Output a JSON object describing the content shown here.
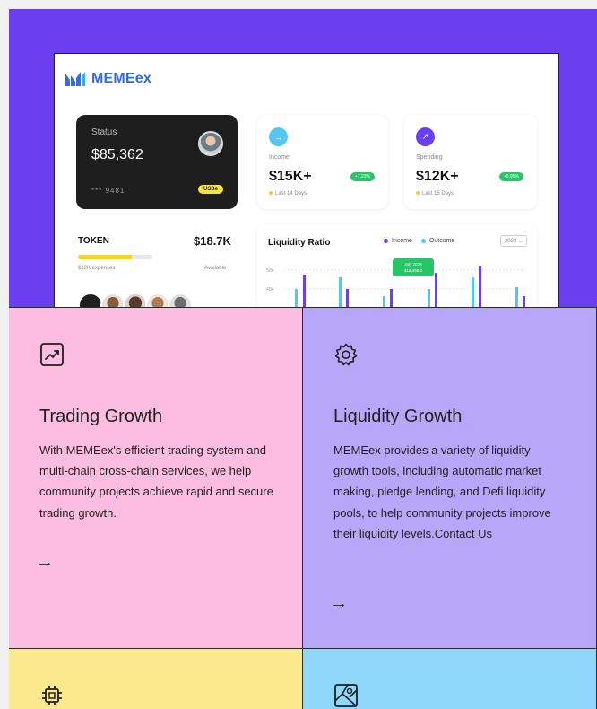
{
  "theme": {
    "hero_bg": "#6a3ff0",
    "card_pink": "#fcbde0",
    "card_lavender": "#b7a7f8",
    "card_yellow": "#fde98d",
    "card_blue": "#8fd7fb"
  },
  "dashboard": {
    "logo_text": "MEMEex",
    "status": {
      "label": "Status",
      "value": "$85,362",
      "card_number": "*** 9481",
      "pill": "USDe"
    },
    "income": {
      "label": "Income",
      "value": "$15K+",
      "badge": "+7.23%",
      "sub": "Last 14 Days",
      "color": "#54c7f0"
    },
    "spending": {
      "label": "Spending",
      "value": "$12K+",
      "badge": "+8.95%",
      "sub": "Last 15 Days",
      "color": "#6a3ff0"
    },
    "token": {
      "title": "TOKEN",
      "value": "$18.7K",
      "progress": 0.72,
      "sub": "$12K expenses",
      "available": "Available"
    },
    "liquidity_chart": {
      "title": "Liquidity Ratio",
      "legend": [
        "Income",
        "Outcome"
      ],
      "year": "2023",
      "tooltip": [
        "July 2023",
        "$16,458.3"
      ],
      "y_ticks": [
        "50k",
        "40k"
      ]
    }
  },
  "features": [
    {
      "title": "Trading Growth",
      "text": "With MEMEex's efficient trading system and multi-chain cross-chain services, we help community projects achieve rapid and secure trading growth.",
      "arrow": "→",
      "icon": "chart-up-icon"
    },
    {
      "title": "Liquidity Growth",
      "text": "MEMEex provides a variety of liquidity growth tools, including automatic market making, pledge lending, and Defi liquidity pools, to help community projects improve their liquidity levels.Contact Us",
      "arrow": "→",
      "icon": "gear-icon"
    },
    {
      "icon": "chip-icon"
    },
    {
      "icon": "map-icon"
    }
  ]
}
